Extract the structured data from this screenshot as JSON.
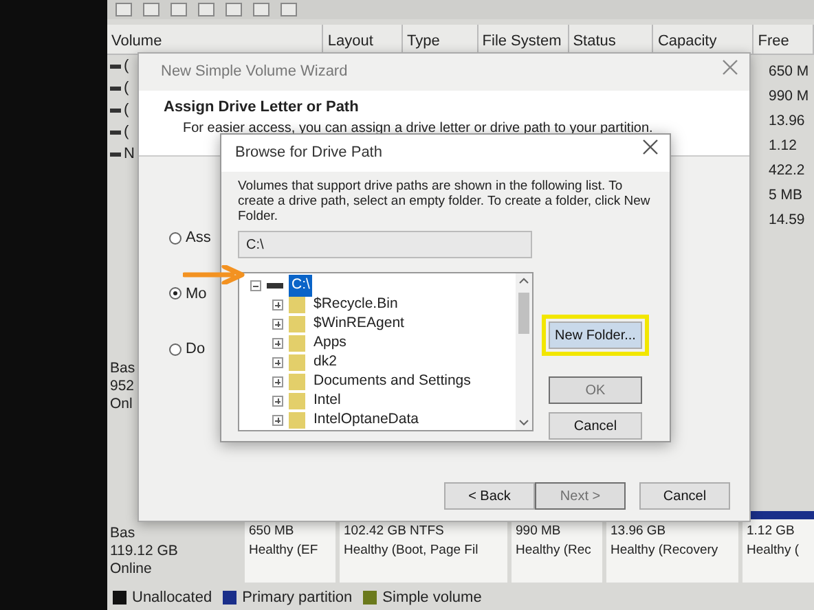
{
  "volume_table": {
    "columns": [
      "Volume",
      "Layout",
      "Type",
      "File System",
      "Status",
      "Capacity",
      "Free"
    ],
    "volume_cells": [
      "(",
      "(",
      "(",
      "(",
      "N"
    ],
    "free_cells": [
      "650 M",
      "990 M",
      "13.96",
      "1.12",
      "422.2",
      "5 MB",
      "14.59"
    ]
  },
  "disks": [
    {
      "labels": [
        "Bas",
        "952",
        "Onl"
      ]
    },
    {
      "labels": [
        "Bas",
        "119.12 GB",
        "Online"
      ],
      "partitions": [
        {
          "size": "650 MB",
          "status": "Healthy (EF"
        },
        {
          "size": "102.42 GB NTFS",
          "status": "Healthy (Boot, Page Fil"
        },
        {
          "size": "990 MB",
          "status": "Healthy (Rec"
        },
        {
          "size": "13.96 GB",
          "status": "Healthy (Recovery"
        },
        {
          "size": "1.12 GB",
          "status": "Healthy ("
        }
      ]
    }
  ],
  "legend": [
    {
      "label": "Unallocated",
      "color": "#111111"
    },
    {
      "label": "Primary partition",
      "color": "#1a2f8a"
    },
    {
      "label": "Simple volume",
      "color": "#6b7a1c"
    }
  ],
  "wizard": {
    "title": "New Simple Volume Wizard",
    "heading": "Assign Drive Letter or Path",
    "subtitle": "For easier access, you can assign a drive letter or drive path to your partition.",
    "options": [
      {
        "label": "Ass",
        "selected": false
      },
      {
        "label": "Mo",
        "selected": true
      },
      {
        "label": "Do",
        "selected": false
      }
    ],
    "buttons": [
      {
        "label": "< Back",
        "disabled": false
      },
      {
        "label": "Next >",
        "disabled": true
      },
      {
        "label": "Cancel",
        "disabled": false
      }
    ]
  },
  "browse": {
    "title": "Browse for Drive Path",
    "description": "Volumes that support drive paths are shown in the following list. To create a drive path, select an empty folder. To create a folder, click New Folder.",
    "path": "C:\\",
    "tree": [
      {
        "label": "C:\\",
        "selected": true,
        "expanded": true,
        "pointed": true,
        "children": [
          {
            "label": "$Recycle.Bin",
            "selected": false,
            "expanded": false
          },
          {
            "label": "$WinREAgent",
            "selected": false,
            "expanded": false
          },
          {
            "label": "Apps",
            "selected": false,
            "expanded": false
          },
          {
            "label": "dk2",
            "selected": false,
            "expanded": false
          },
          {
            "label": "Documents and Settings",
            "selected": false,
            "expanded": false
          },
          {
            "label": "Intel",
            "selected": false,
            "expanded": false
          },
          {
            "label": "IntelOptaneData",
            "selected": false,
            "expanded": false
          }
        ]
      }
    ],
    "buttons": [
      {
        "label": "New Folder...",
        "disabled": false,
        "highlighted": true
      },
      {
        "label": "OK",
        "disabled": true,
        "highlighted": false
      },
      {
        "label": "Cancel",
        "disabled": false,
        "highlighted": false
      }
    ]
  }
}
